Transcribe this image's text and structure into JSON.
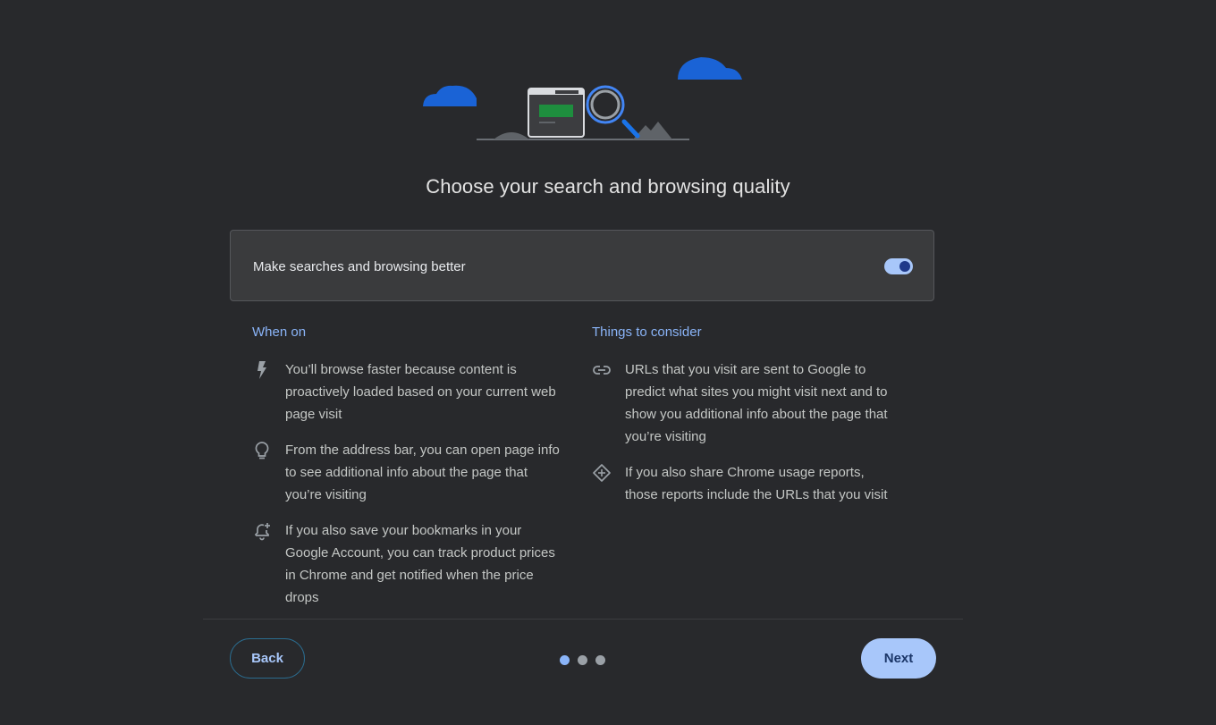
{
  "header": {
    "title": "Choose your search and browsing quality"
  },
  "toggle": {
    "label": "Make searches and browsing better",
    "enabled": true
  },
  "when_on": {
    "heading": "When on",
    "items": [
      {
        "icon": "lightning-icon",
        "text": "You’ll browse faster because content is proactively loaded based on your current web page visit"
      },
      {
        "icon": "lightbulb-icon",
        "text": "From the address bar, you can open page info to see additional info about the page that you’re visiting"
      },
      {
        "icon": "price-alert-bell-icon",
        "text": "If you also save your bookmarks in your Google Account, you can track product prices in Chrome and get notified when the price drops"
      }
    ]
  },
  "things_to_consider": {
    "heading": "Things to consider",
    "items": [
      {
        "icon": "link-icon",
        "text": "URLs that you visit are sent to Google to predict what sites you might visit next and to show you additional info about the page that you’re visiting"
      },
      {
        "icon": "usage-reports-icon",
        "text": "If you also share Chrome usage reports, those reports include the URLs that you visit"
      }
    ]
  },
  "footer": {
    "back_label": "Back",
    "next_label": "Next",
    "step_current": 1,
    "step_total": 3
  },
  "colors": {
    "background": "#28292c",
    "accent": "#a8c7fa",
    "link": "#8ab4f8"
  }
}
